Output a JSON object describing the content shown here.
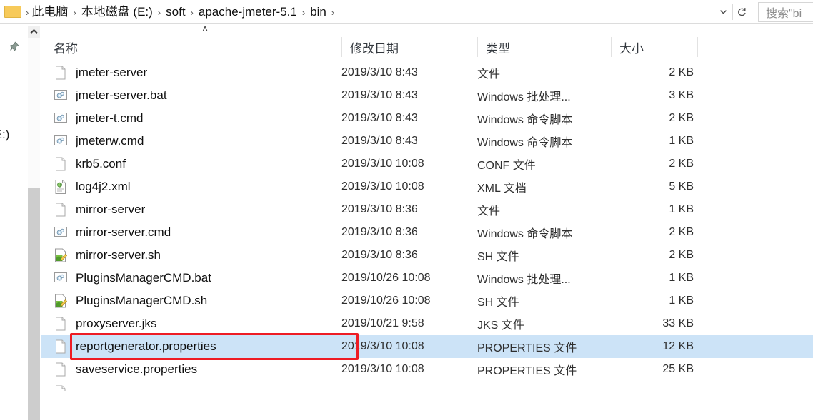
{
  "window": {
    "type": "file-explorer",
    "accent_selection_color": "#cce3f7",
    "annotation_color": "#ee1c24"
  },
  "addressbar": {
    "back_icon": "folder-icon",
    "separator": "›",
    "crumbs": [
      "此电脑",
      "本地磁盘 (E:)",
      "soft",
      "apache-jmeter-5.1",
      "bin"
    ],
    "history_dropdown_icon": "chevron-down-icon",
    "refresh_icon": "refresh-icon"
  },
  "search": {
    "placeholder": "搜索\"bi",
    "icon": "search-icon"
  },
  "navpane": {
    "pin_icon": "pushpin-icon",
    "clipped_label": "(E:)",
    "scroll_up_icon": "chevron-up-icon"
  },
  "columns": {
    "sort_indicator": "˄",
    "headers": [
      {
        "label": "名称",
        "key": "name"
      },
      {
        "label": "修改日期",
        "key": "date"
      },
      {
        "label": "类型",
        "key": "type"
      },
      {
        "label": "大小",
        "key": "size"
      }
    ]
  },
  "rows": [
    {
      "name": "jmeter-server",
      "date": "2019/3/10 8:43",
      "type": "文件",
      "size": "2 KB",
      "icon": "blank-file-icon",
      "selected": false
    },
    {
      "name": "jmeter-server.bat",
      "date": "2019/3/10 8:43",
      "type": "Windows 批处理...",
      "size": "3 KB",
      "icon": "gears-file-icon",
      "selected": false
    },
    {
      "name": "jmeter-t.cmd",
      "date": "2019/3/10 8:43",
      "type": "Windows 命令脚本",
      "size": "2 KB",
      "icon": "gears-file-icon",
      "selected": false
    },
    {
      "name": "jmeterw.cmd",
      "date": "2019/3/10 8:43",
      "type": "Windows 命令脚本",
      "size": "1 KB",
      "icon": "gears-file-icon",
      "selected": false
    },
    {
      "name": "krb5.conf",
      "date": "2019/3/10 10:08",
      "type": "CONF 文件",
      "size": "2 KB",
      "icon": "blank-file-icon",
      "selected": false
    },
    {
      "name": "log4j2.xml",
      "date": "2019/3/10 10:08",
      "type": "XML 文档",
      "size": "5 KB",
      "icon": "xml-file-icon",
      "selected": false
    },
    {
      "name": "mirror-server",
      "date": "2019/3/10 8:36",
      "type": "文件",
      "size": "1 KB",
      "icon": "blank-file-icon",
      "selected": false
    },
    {
      "name": "mirror-server.cmd",
      "date": "2019/3/10 8:36",
      "type": "Windows 命令脚本",
      "size": "2 KB",
      "icon": "gears-file-icon",
      "selected": false
    },
    {
      "name": "mirror-server.sh",
      "date": "2019/3/10 8:36",
      "type": "SH 文件",
      "size": "2 KB",
      "icon": "sh-file-icon",
      "selected": false
    },
    {
      "name": "PluginsManagerCMD.bat",
      "date": "2019/10/26 10:08",
      "type": "Windows 批处理...",
      "size": "1 KB",
      "icon": "gears-file-icon",
      "selected": false
    },
    {
      "name": "PluginsManagerCMD.sh",
      "date": "2019/10/26 10:08",
      "type": "SH 文件",
      "size": "1 KB",
      "icon": "sh-file-icon",
      "selected": false
    },
    {
      "name": "proxyserver.jks",
      "date": "2019/10/21 9:58",
      "type": "JKS 文件",
      "size": "33 KB",
      "icon": "blank-file-icon",
      "selected": false
    },
    {
      "name": "reportgenerator.properties",
      "date": "2019/3/10 10:08",
      "type": "PROPERTIES 文件",
      "size": "12 KB",
      "icon": "blank-file-icon",
      "selected": true
    },
    {
      "name": "saveservice.properties",
      "date": "2019/3/10 10:08",
      "type": "PROPERTIES 文件",
      "size": "25 KB",
      "icon": "blank-file-icon",
      "selected": false
    }
  ]
}
